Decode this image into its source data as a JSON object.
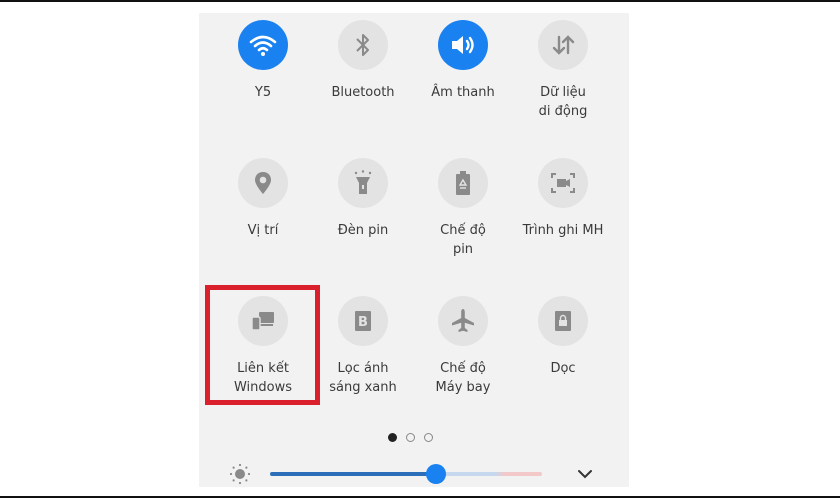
{
  "quick_settings": {
    "tiles": [
      {
        "id": "wifi",
        "label": "Y5",
        "icon": "wifi-icon",
        "active": true
      },
      {
        "id": "bluetooth",
        "label": "Bluetooth",
        "icon": "bluetooth-icon",
        "active": false
      },
      {
        "id": "sound",
        "label": "Âm thanh",
        "icon": "volume-icon",
        "active": true
      },
      {
        "id": "mobile-data",
        "label": "Dữ liệu\ndi động",
        "icon": "data-transfer-icon",
        "active": false
      },
      {
        "id": "location",
        "label": "Vị trí",
        "icon": "location-pin-icon",
        "active": false
      },
      {
        "id": "flashlight",
        "label": "Đèn pin",
        "icon": "flashlight-icon",
        "active": false
      },
      {
        "id": "power-mode",
        "label": "Chế độ\npin",
        "icon": "battery-saver-icon",
        "active": false
      },
      {
        "id": "screen-recorder",
        "label": "Trình ghi MH",
        "icon": "screen-record-icon",
        "active": false
      },
      {
        "id": "link-windows",
        "label": "Liên kết\nWindows",
        "icon": "link-devices-icon",
        "active": false
      },
      {
        "id": "blue-light",
        "label": "Lọc ánh\nsáng xanh",
        "icon": "blue-light-filter-icon",
        "active": false
      },
      {
        "id": "airplane",
        "label": "Chế độ\nMáy bay",
        "icon": "airplane-icon",
        "active": false
      },
      {
        "id": "portrait",
        "label": "Dọc",
        "icon": "rotation-lock-icon",
        "active": false
      }
    ],
    "highlighted_tile": "link-windows",
    "pagination": {
      "current": 1,
      "total": 3
    },
    "brightness": {
      "value_fraction": 0.61
    },
    "colors": {
      "accent": "#1a82f0",
      "highlight": "#d9202c",
      "panel": "#f2f2f2",
      "icon_inactive": "#8a8a8a"
    }
  }
}
